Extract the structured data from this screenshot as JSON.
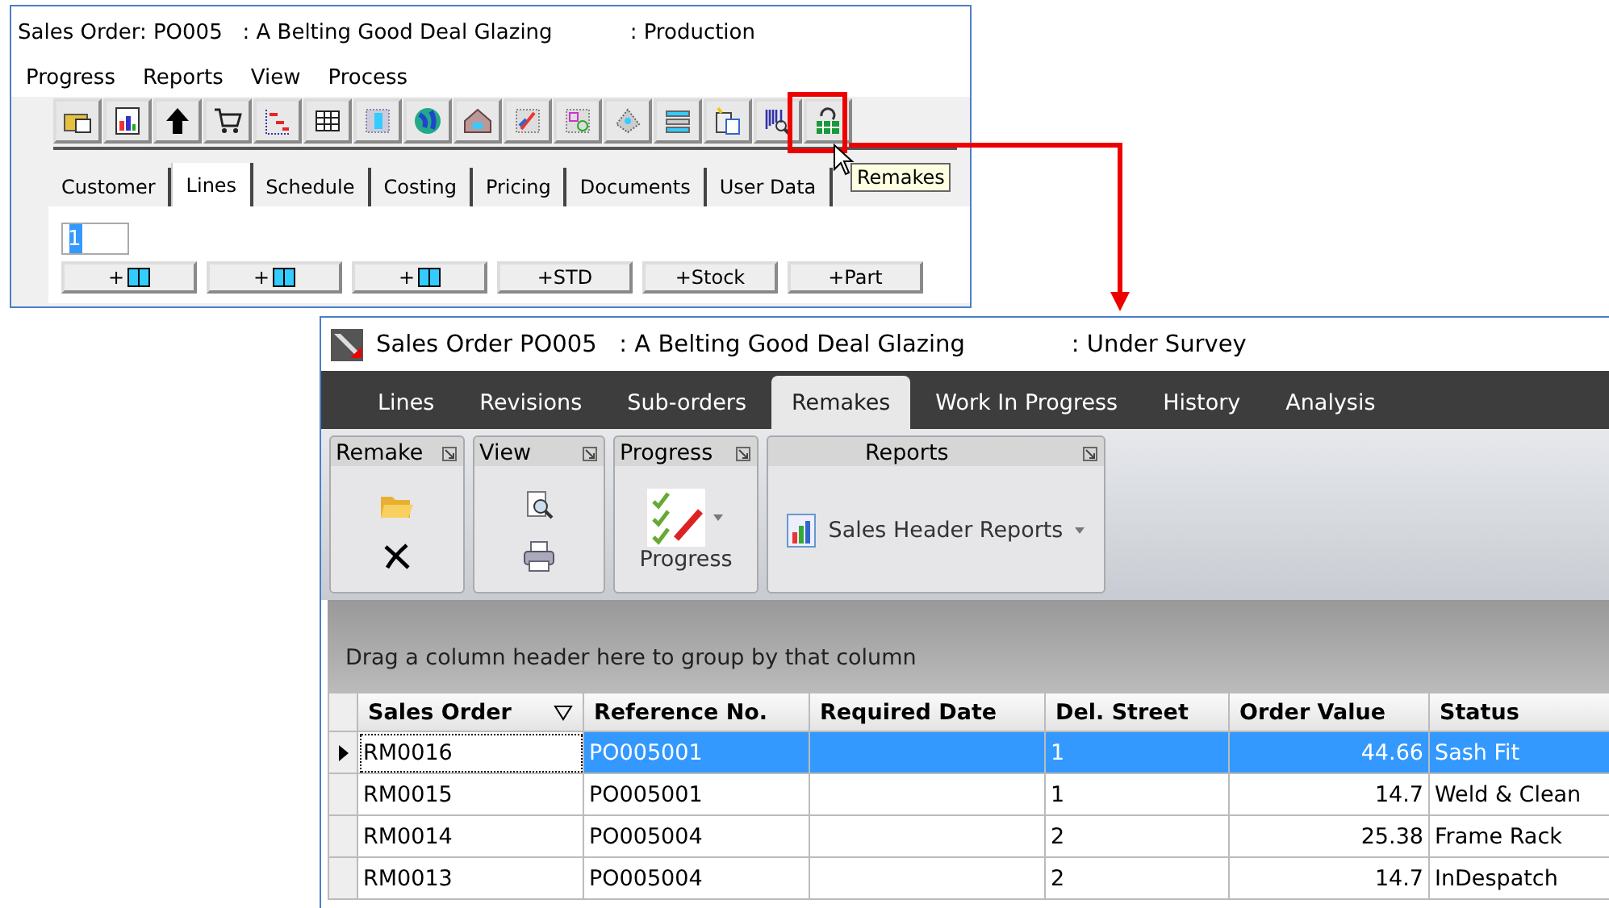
{
  "old_window": {
    "title": "Sales Order: PO005   : A Belting Good Deal Glazing",
    "status": ": Production",
    "menu": [
      "Progress",
      "Reports",
      "View",
      "Process"
    ],
    "tooltip": "Remakes",
    "tabs": [
      {
        "label": "Customer",
        "selected": false
      },
      {
        "label": "Lines",
        "selected": true
      },
      {
        "label": "Schedule",
        "selected": false
      },
      {
        "label": "Costing",
        "selected": false
      },
      {
        "label": "Pricing",
        "selected": false
      },
      {
        "label": "Documents",
        "selected": false
      },
      {
        "label": "User Data",
        "selected": false
      }
    ],
    "line_field": {
      "value": "1"
    },
    "add_buttons": [
      {
        "kind": "icon",
        "label": "+"
      },
      {
        "kind": "icon",
        "label": "+"
      },
      {
        "kind": "icon",
        "label": "+"
      },
      {
        "kind": "text",
        "label": "+STD"
      },
      {
        "kind": "text",
        "label": "+Stock"
      },
      {
        "kind": "text",
        "label": "+Part"
      }
    ]
  },
  "new_window": {
    "title": "Sales Order PO005   : A Belting Good Deal Glazing",
    "status": ": Under Survey",
    "tabs": [
      {
        "label": "Lines",
        "selected": false
      },
      {
        "label": "Revisions",
        "selected": false
      },
      {
        "label": "Sub-orders",
        "selected": false
      },
      {
        "label": "Remakes",
        "selected": true
      },
      {
        "label": "Work In Progress",
        "selected": false
      },
      {
        "label": "History",
        "selected": false
      },
      {
        "label": "Analysis",
        "selected": false
      }
    ],
    "ribbon_groups": [
      {
        "kind": "remake",
        "label": "Remake"
      },
      {
        "kind": "view",
        "label": "View"
      },
      {
        "kind": "progress",
        "label": "Progress",
        "button": "Progress"
      },
      {
        "kind": "reports",
        "label": "Reports",
        "button": "Sales Header Reports"
      }
    ],
    "group_panel": "Drag a column header here to group by that column",
    "table": {
      "columns": [
        "Sales Order",
        "Reference No.",
        "Required Date",
        "Del. Street",
        "Order Value",
        "Status"
      ],
      "rows": [
        {
          "selected": true,
          "cells": [
            "RM0016",
            "PO005001",
            "",
            "1",
            "44.66",
            "Sash Fit"
          ]
        },
        {
          "selected": false,
          "cells": [
            "RM0015",
            "PO005001",
            "",
            "1",
            "14.7",
            "Weld & Clean"
          ]
        },
        {
          "selected": false,
          "cells": [
            "RM0014",
            "PO005004",
            "",
            "2",
            "25.38",
            "Frame Rack"
          ]
        },
        {
          "selected": false,
          "cells": [
            "RM0013",
            "PO005004",
            "",
            "2",
            "14.7",
            "InDespatch"
          ]
        }
      ]
    }
  }
}
